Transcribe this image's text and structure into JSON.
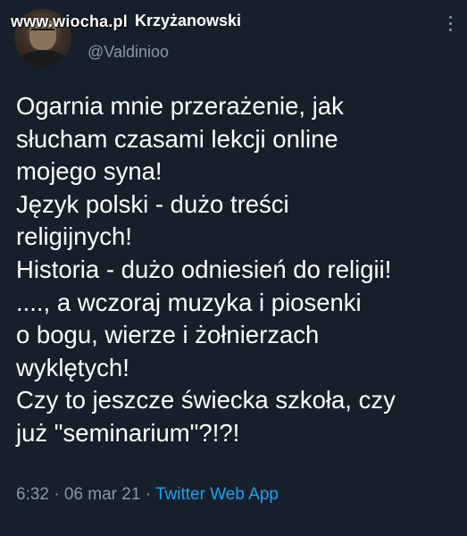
{
  "watermark": "www.wiocha.pl",
  "author": {
    "display_name": "Krzyżanowski",
    "handle": "@Valdinioo"
  },
  "tweet": {
    "text": "Ogarnia mnie przerażenie, jak\nsłucham czasami lekcji online\nmojego syna!\nJęzyk polski - dużo treści\nreligijnych!\nHistoria - dużo odniesień do religii!\n...., a wczoraj muzyka i piosenki\no bogu, wierze i żołnierzach\nwyklętych!\nCzy to jeszcze świecka szkoła, czy\njuż \"seminarium\"?!?!",
    "time": "6:32",
    "separator": "·",
    "date": "06 mar 21",
    "source": "Twitter Web App"
  },
  "icons": {
    "avatar": "user-avatar",
    "more": "more-options-icon"
  },
  "colors": {
    "background": "#15202b",
    "text_primary": "#ffffff",
    "text_secondary": "#8899a6",
    "link": "#1da1f2"
  }
}
